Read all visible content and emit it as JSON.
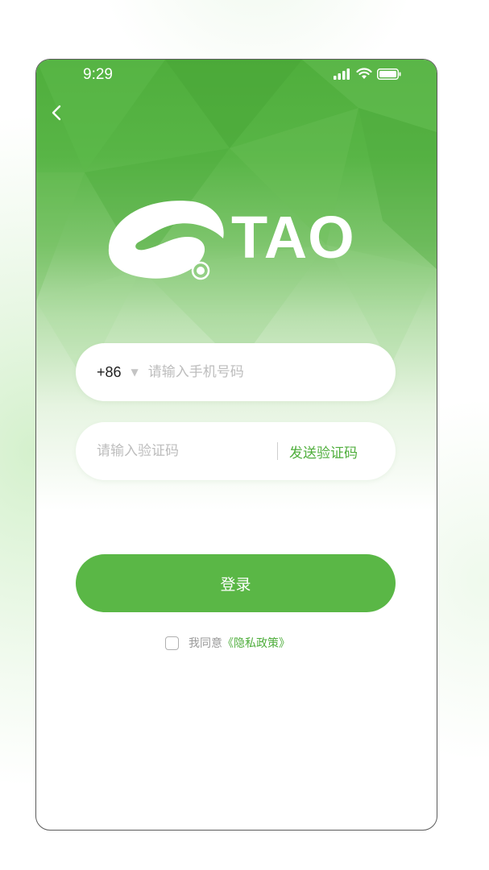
{
  "status_bar": {
    "time": "9:29",
    "icons": [
      "signal-icon",
      "wifi-icon",
      "battery-icon"
    ]
  },
  "nav": {
    "back_icon": "chevron-left-icon"
  },
  "brand": {
    "logo_text": "TAO"
  },
  "form": {
    "country_code": "+86",
    "country_caret": "▼",
    "phone_placeholder": "请输入手机号码",
    "code_placeholder": "请输入验证码",
    "send_code_label": "发送验证码"
  },
  "actions": {
    "login_label": "登录"
  },
  "agreement": {
    "checked": false,
    "text": "我同意",
    "policy_link": "《隐私政策》"
  },
  "colors": {
    "accent": "#5ab746",
    "accent_dark": "#4fae3c",
    "placeholder": "#bdbdbd"
  }
}
